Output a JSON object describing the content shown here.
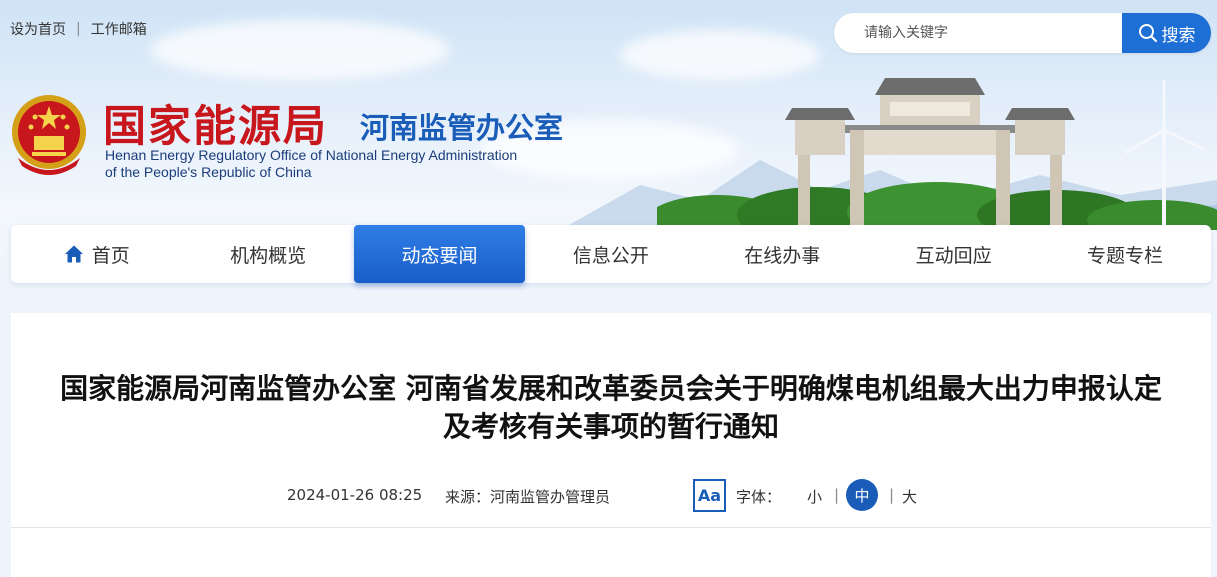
{
  "toplinks": {
    "home": "设为首页",
    "sep": "|",
    "mail": "工作邮箱"
  },
  "search": {
    "placeholder": "请输入关键字",
    "button": "搜索"
  },
  "logo": {
    "cn_main": "国家能源局",
    "cn_sub": "河南监管办公室",
    "en_line1": "Henan Energy Regulatory Office of National Energy Administration",
    "en_line2": "of the People's Republic of China"
  },
  "nav": {
    "items": [
      {
        "label": "首页",
        "icon": "home-icon"
      },
      {
        "label": "机构概览"
      },
      {
        "label": "动态要闻",
        "active": true
      },
      {
        "label": "信息公开"
      },
      {
        "label": "在线办事"
      },
      {
        "label": "互动回应"
      },
      {
        "label": "专题专栏"
      }
    ]
  },
  "article": {
    "title_line1": "国家能源局河南监管办公室 河南省发展和改革委员会关于明确煤电机组最大出力申报认定",
    "title_line2": "及考核有关事项的暂行通知",
    "date": "2024-01-26 08:25",
    "source": "来源：河南监管办管理员",
    "aa": "Aa",
    "font_label": "字体：",
    "font_small": "小",
    "font_mid": "中",
    "font_large": "大",
    "sep": "|"
  },
  "colors": {
    "accent": "#1a5db8",
    "brand_red": "#c8161d",
    "nav_active": "#2f7de6"
  }
}
